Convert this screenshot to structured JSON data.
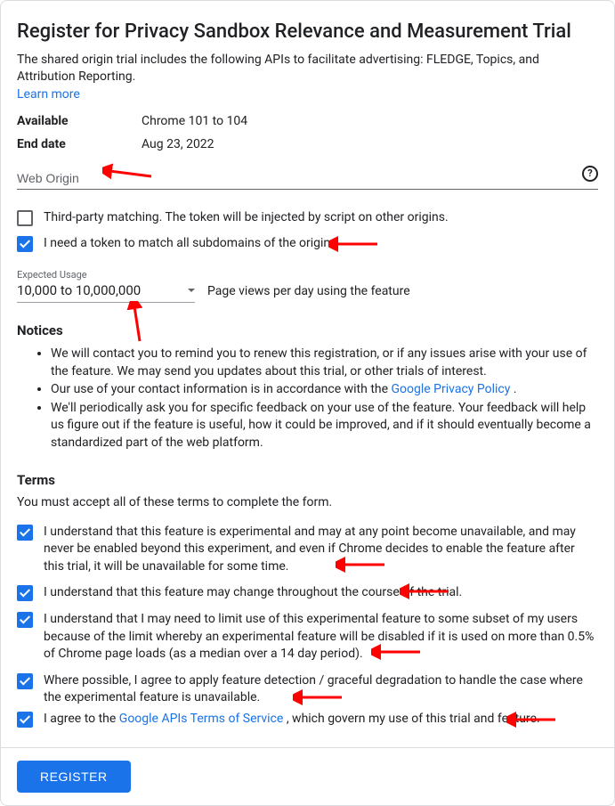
{
  "title": "Register for Privacy Sandbox Relevance and Measurement Trial",
  "description": "The shared origin trial includes the following APIs to facilitate advertising: FLEDGE, Topics, and Attribution Reporting.",
  "learn_more": "Learn more",
  "meta": {
    "available_label": "Available",
    "available_value": "Chrome 101 to 104",
    "enddate_label": "End date",
    "enddate_value": "Aug 23, 2022"
  },
  "origin": {
    "placeholder": "Web Origin",
    "value": ""
  },
  "opts": {
    "thirdparty": "Third-party matching. The token will be injected by script on other origins.",
    "subdomain": "I need a token to match all subdomains of the origin."
  },
  "usage": {
    "label": "Expected Usage",
    "value": "10,000 to 10,000,000",
    "suffix": "Page views per day using the feature"
  },
  "notices": {
    "heading": "Notices",
    "items": [
      "We will contact you to remind you to renew this registration, or if any issues arise with your use of the feature. We may send you updates about this trial, or other trials of interest.",
      "",
      "We'll periodically ask you for specific feedback on your use of the feature. Your feedback will help us figure out if the feature is useful, how it could be improved, and if it should eventually become a standardized part of the web platform."
    ],
    "item1_prefix": "Our use of your contact information is in accordance with the ",
    "item1_link": "Google Privacy Policy",
    "item1_suffix": " ."
  },
  "terms": {
    "heading": "Terms",
    "intro": "You must accept all of these terms to complete the form.",
    "t0": "I understand that this feature is experimental and may at any point become unavailable, and may never be enabled beyond this experiment, and even if Chrome decides to enable the feature after this trial, it will be unavailable for some time.",
    "t1": "I understand that this feature may change throughout the course of the trial.",
    "t2": "I understand that I may need to limit use of this experimental feature to some subset of my users because of the limit whereby an experimental feature will be disabled if it is used on more than 0.5% of Chrome page loads (as a median over a 14 day period).",
    "t3": "Where possible, I agree to apply feature detection / graceful degradation to handle the case where the experimental feature is unavailable.",
    "t4_prefix": "I agree to the ",
    "t4_link": "Google APIs Terms of Service",
    "t4_suffix": " , which govern my use of this trial and feature."
  },
  "register": "Register"
}
